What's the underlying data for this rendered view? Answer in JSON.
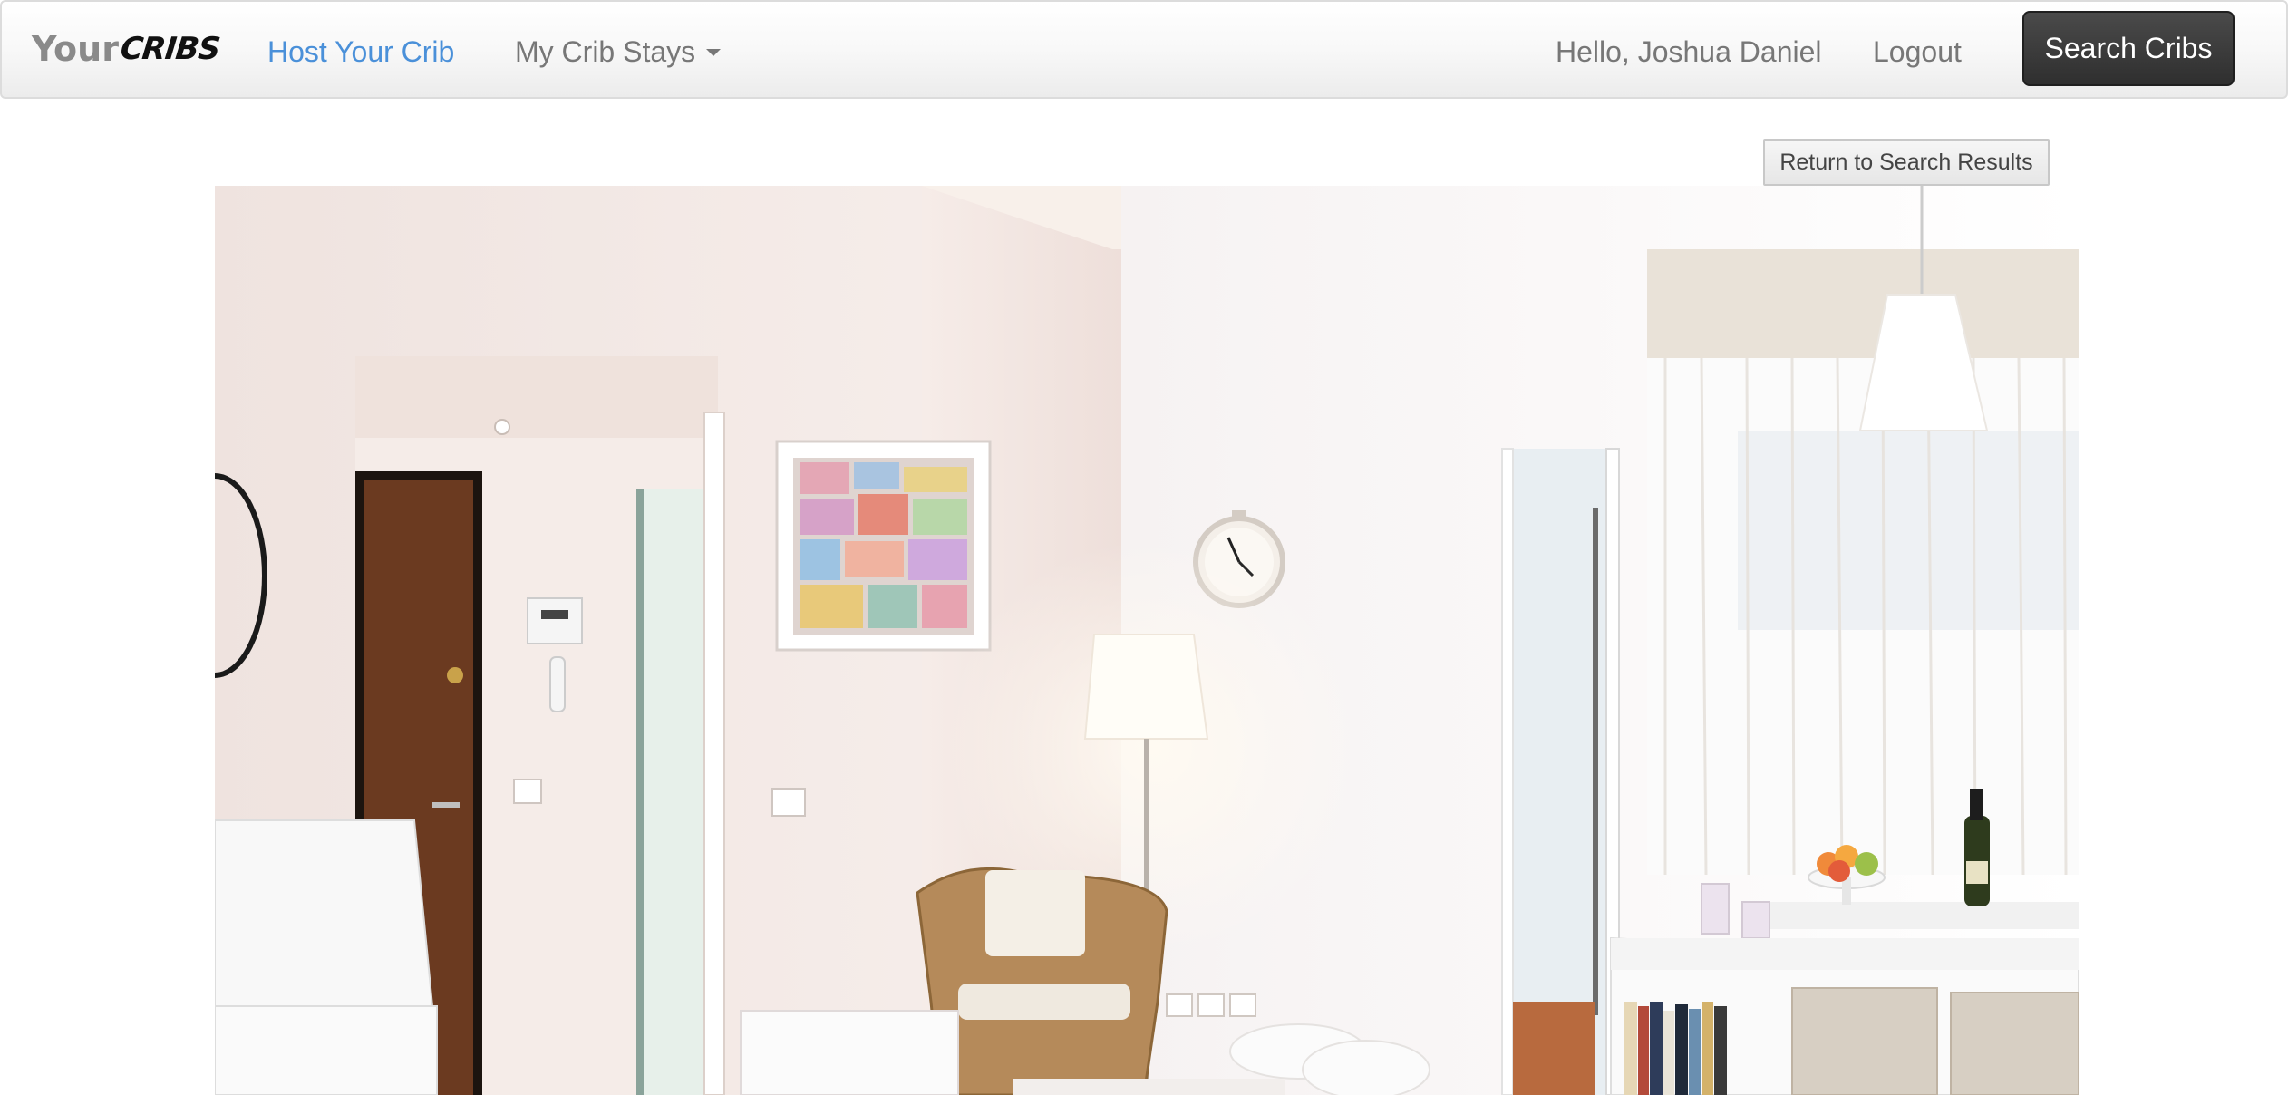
{
  "navbar": {
    "brand_your": "Your",
    "brand_cribs": "CRIBS",
    "host_link": "Host Your Crib",
    "stays_link": "My Crib Stays",
    "greeting": "Hello, Joshua Daniel",
    "logout": "Logout",
    "search_button": "Search Cribs"
  },
  "content": {
    "return_button": "Return to Search Results",
    "listing_photo": "interior-living-room-photo"
  },
  "colors": {
    "active_link": "#4a90d9",
    "nav_text": "#777777",
    "search_button_bg": "#3a3a3a"
  },
  "icons": {
    "stays_dropdown": "caret-down-icon"
  }
}
